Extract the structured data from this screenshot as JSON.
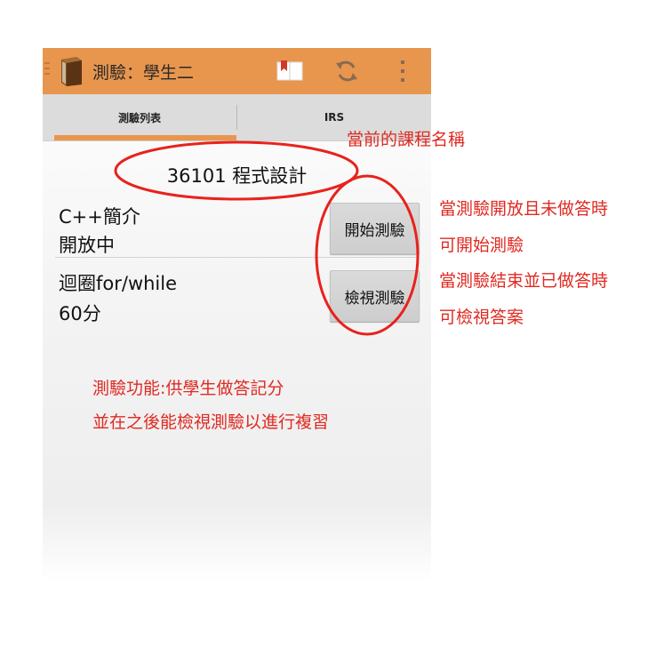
{
  "app": {
    "title": "測驗：學生二"
  },
  "actionbar": {
    "icons": [
      "book-app-icon",
      "bookmark-icon",
      "refresh-icon",
      "overflow-menu-icon"
    ]
  },
  "tabs": [
    {
      "label": "測驗列表",
      "selected": true
    },
    {
      "label": "IRS",
      "selected": false
    }
  ],
  "course": {
    "name": "36101  程式設計"
  },
  "quizzes": [
    {
      "title": "C++簡介",
      "status": "開放中",
      "action": "開始測驗"
    },
    {
      "title": "迴圈for/while",
      "status": "60分",
      "action": "檢視測驗"
    }
  ],
  "annotations": {
    "course_note": "當前的課程名稱",
    "start_note_1": "當測驗開放且未做答時",
    "start_note_2": "可開始測驗",
    "review_note_1": "當測驗結束並已做答時",
    "review_note_2": "可檢視答案",
    "feature_1": "測驗功能:供學生做答記分",
    "feature_2": "並在之後能檢視測驗以進行複習"
  },
  "colors": {
    "accent": "#e8964e",
    "annotation": "#e02a22"
  }
}
